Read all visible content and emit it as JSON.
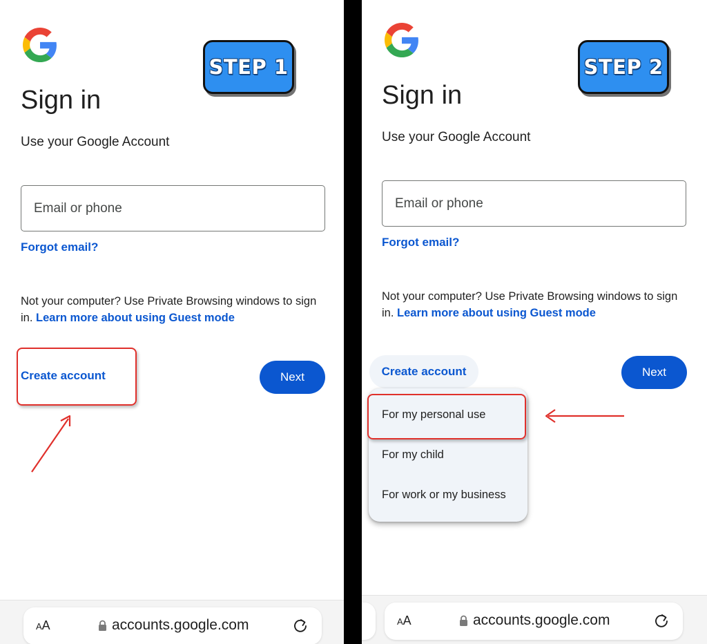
{
  "colors": {
    "link_blue": "#0b57d0",
    "badge_blue": "#2e8ff0",
    "annotation_red": "#e0302b",
    "menu_background": "#f0f4f9"
  },
  "step1": {
    "badge": "STEP 1",
    "title": "Sign in",
    "subtitle": "Use your Google Account",
    "email_placeholder": "Email or phone",
    "forgot_email": "Forgot email?",
    "notice_text": "Not your computer? Use Private Browsing windows to sign in.",
    "guest_link": "Learn more about using Guest mode",
    "create_account": "Create account",
    "next": "Next"
  },
  "step2": {
    "badge": "STEP 2",
    "title": "Sign in",
    "subtitle": "Use your Google Account",
    "email_placeholder": "Email or phone",
    "forgot_email": "Forgot email?",
    "notice_text": "Not your computer? Use Private Browsing windows to sign in.",
    "guest_link": "Learn more about using Guest mode",
    "create_account": "Create account",
    "next": "Next",
    "menu_items": [
      "For my personal use",
      "For my child",
      "For work or my business"
    ]
  },
  "browser": {
    "text_size_small": "A",
    "text_size_large": "A",
    "url": "accounts.google.com",
    "icons": [
      "lock-icon",
      "reload-icon"
    ]
  }
}
